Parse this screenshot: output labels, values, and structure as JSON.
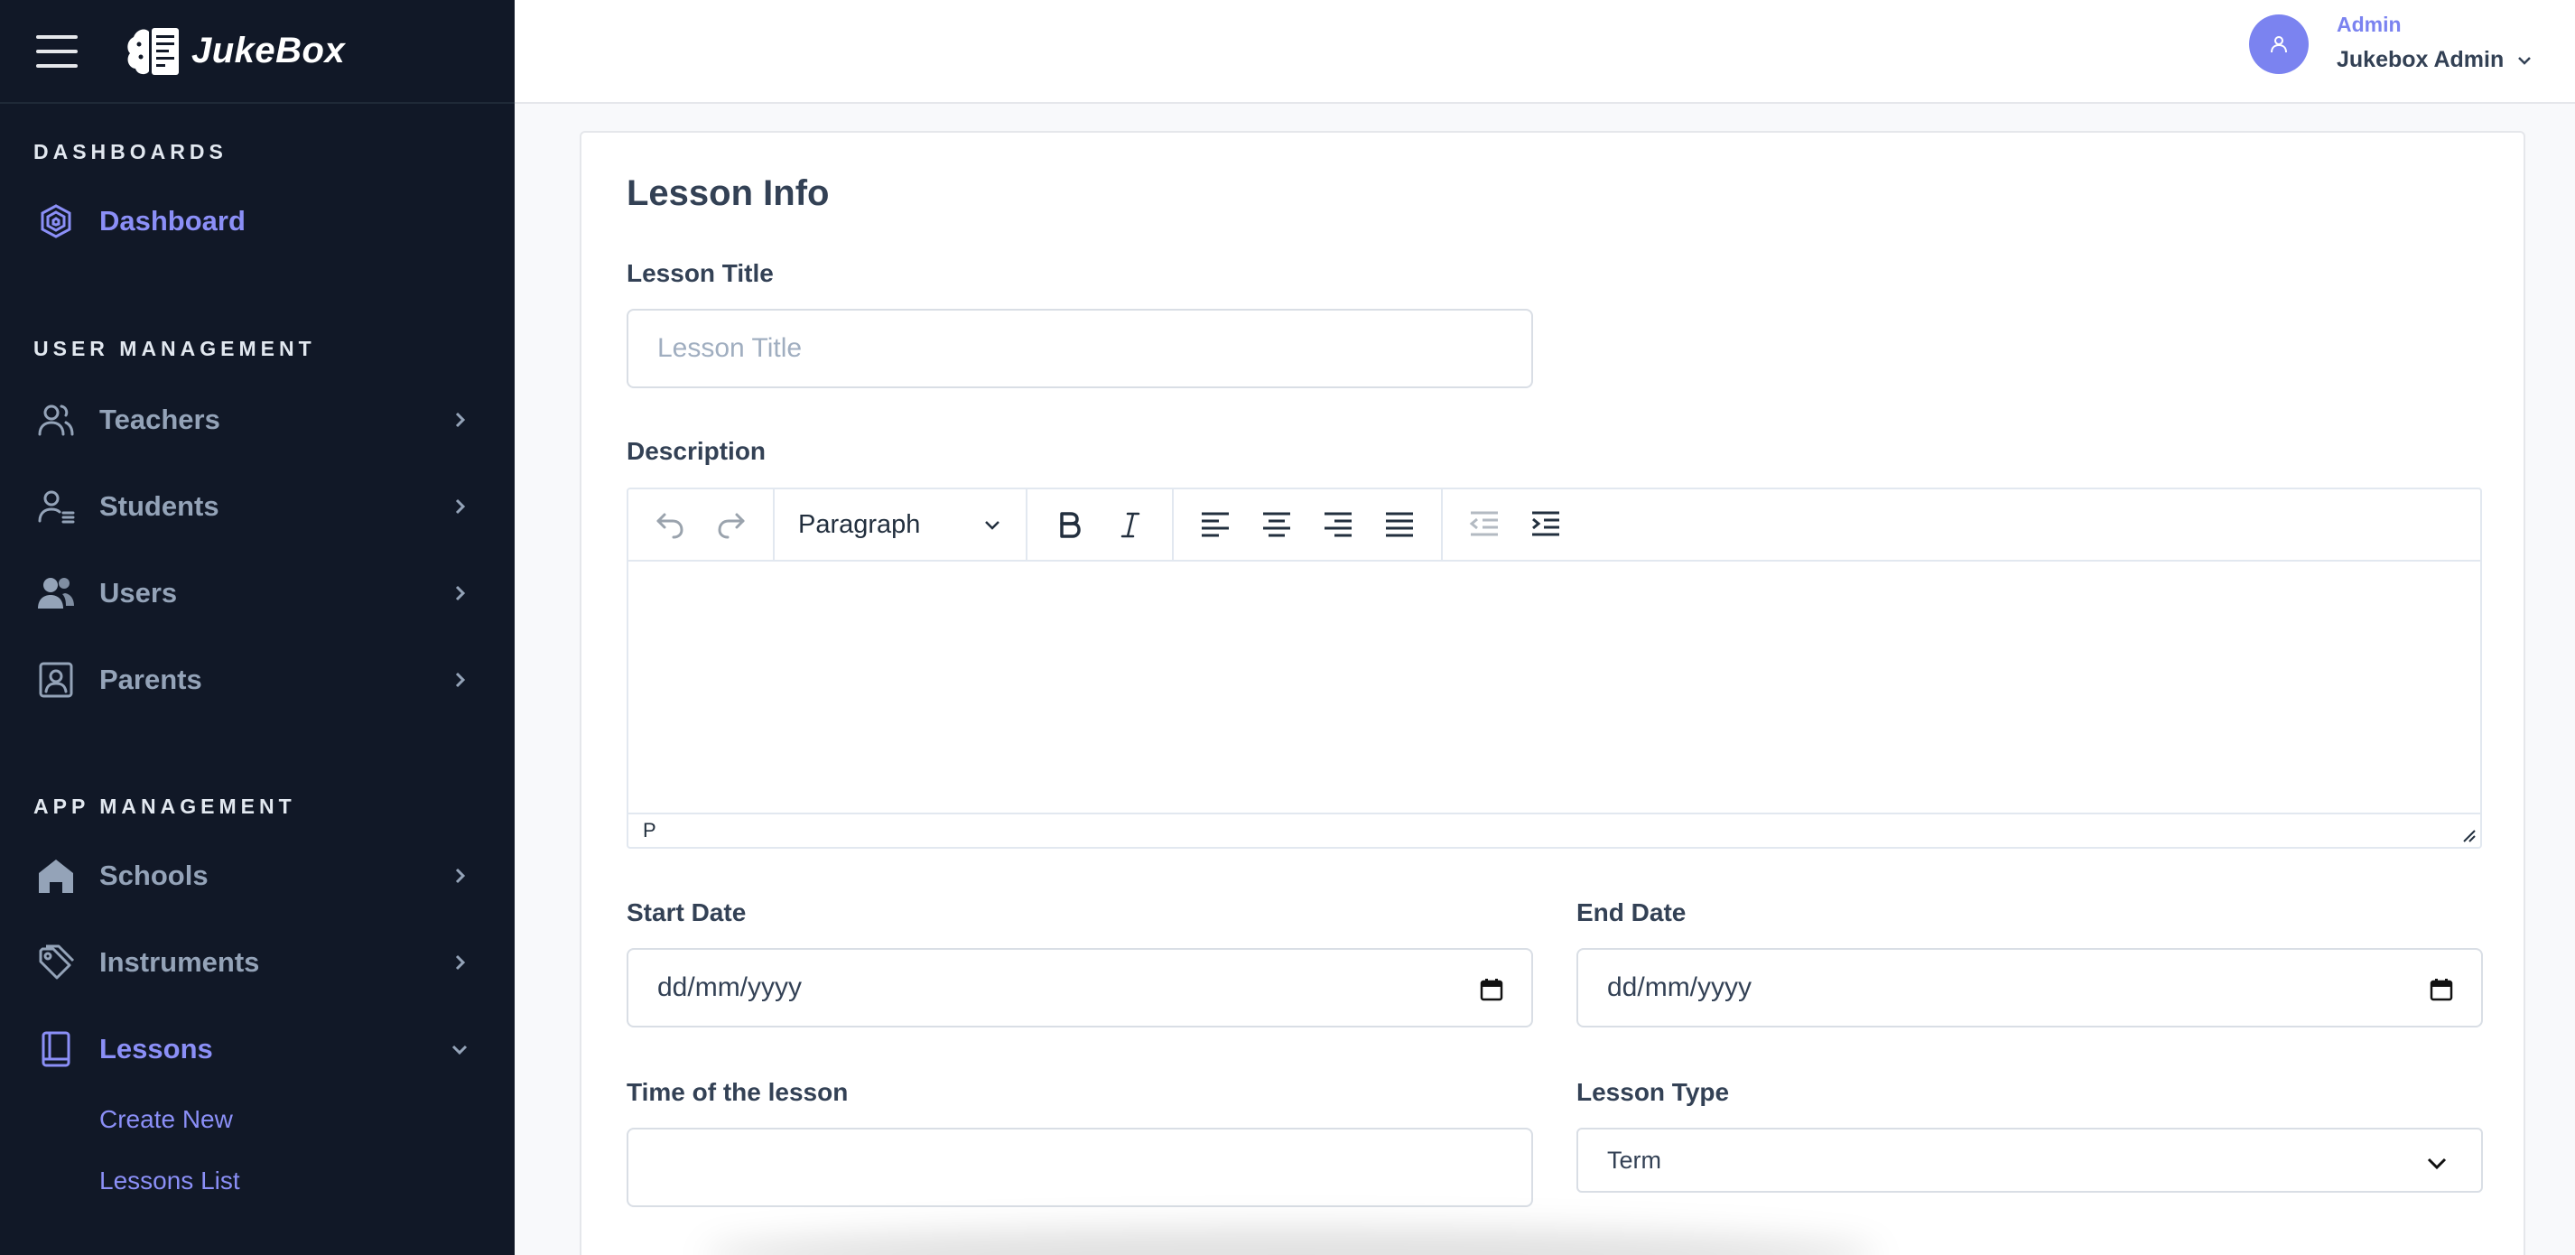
{
  "app": {
    "name": "JukeBox"
  },
  "sidebar": {
    "sections": {
      "dashboards": "DASHBOARDS",
      "user_management": "USER MANAGEMENT",
      "app_management": "APP MANAGEMENT"
    },
    "items": {
      "dashboard": {
        "label": "Dashboard",
        "icon": "dashboard-icon"
      },
      "teachers": {
        "label": "Teachers",
        "icon": "users-icon"
      },
      "students": {
        "label": "Students",
        "icon": "user-list-icon"
      },
      "users": {
        "label": "Users",
        "icon": "users-fill-icon"
      },
      "parents": {
        "label": "Parents",
        "icon": "id-badge-icon"
      },
      "schools": {
        "label": "Schools",
        "icon": "home-icon"
      },
      "instruments": {
        "label": "Instruments",
        "icon": "tag-icon"
      },
      "lessons": {
        "label": "Lessons",
        "icon": "book-icon"
      }
    },
    "lessons_sub": {
      "create_new": "Create New",
      "lessons_list": "Lessons List"
    }
  },
  "header": {
    "user_role": "Admin",
    "user_name": "Jukebox Admin"
  },
  "form": {
    "title": "Lesson Info",
    "lesson_title": {
      "label": "Lesson Title",
      "placeholder": "Lesson Title",
      "value": ""
    },
    "description": {
      "label": "Description",
      "block_format": "Paragraph",
      "status_path": "P"
    },
    "start_date": {
      "label": "Start Date",
      "value": "dd/mm/yyyy"
    },
    "end_date": {
      "label": "End Date",
      "value": "dd/mm/yyyy"
    },
    "time": {
      "label": "Time of the lesson",
      "value": ""
    },
    "lesson_type": {
      "label": "Lesson Type",
      "value": "Term"
    }
  },
  "colors": {
    "sidebar_bg": "#111827",
    "accent": "#8b8ff7",
    "avatar": "#7b83f0"
  }
}
